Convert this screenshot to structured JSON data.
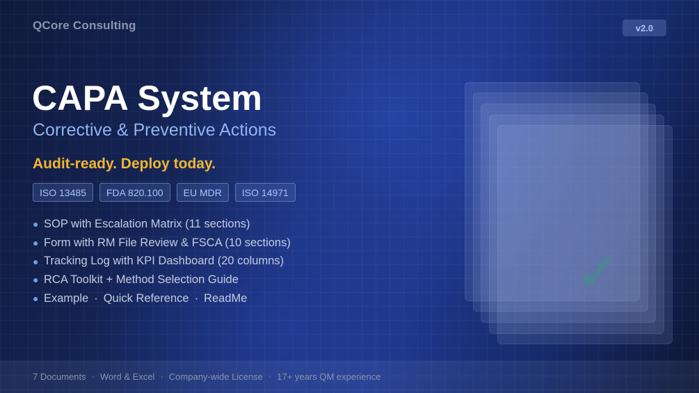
{
  "brand": "QCore Consulting",
  "version": "v2.0",
  "title": "CAPA System",
  "subtitle": "Corrective & Preventive Actions",
  "tagline": "Audit-ready. Deploy today.",
  "badges": [
    "ISO 13485",
    "FDA 820.100",
    "EU MDR",
    "ISO 14971"
  ],
  "features": [
    "SOP with Escalation Matrix (11 sections)",
    "Form with RM File Review & FSCA (10 sections)",
    "Tracking Log with KPI Dashboard (20 columns)",
    "RCA Toolkit + Method Selection Guide"
  ],
  "extras": [
    "Example",
    "Quick Reference",
    "ReadMe"
  ],
  "footer": [
    "7 Documents",
    "Word & Excel",
    "Company-wide License",
    "17+ years QM experience"
  ],
  "colors": {
    "accent_yellow": "#f2b632",
    "subtitle_blue": "#8fb3f2",
    "check_green": "#3c9682"
  },
  "icons": {
    "bullet": "bullet-dot-icon",
    "check": "checkmark-icon"
  }
}
